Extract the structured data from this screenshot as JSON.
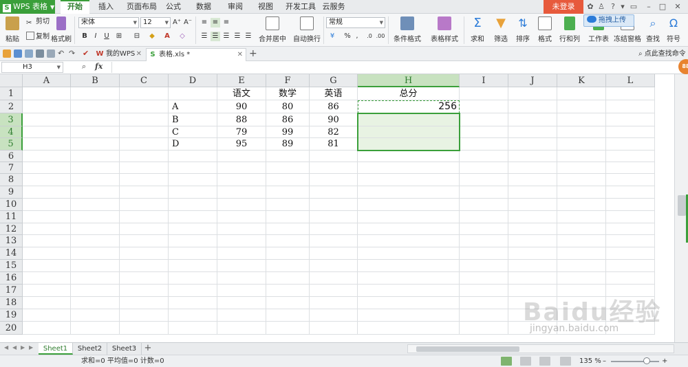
{
  "app": {
    "name": "WPS 表格",
    "menu_tabs": [
      "开始",
      "插入",
      "页面布局",
      "公式",
      "数据",
      "审阅",
      "视图",
      "开发工具",
      "云服务"
    ],
    "login_label": "未登录",
    "upload_tip": "拖拽上传"
  },
  "ribbon": {
    "paste": "粘贴",
    "cut": "剪切",
    "copy": "复制",
    "format_painter": "格式刷",
    "font_name": "宋体",
    "font_size": "12",
    "merge_center": "合并居中",
    "wrap_text": "自动换行",
    "number_format": "常规",
    "conditional_format": "条件格式",
    "table_style": "表格样式",
    "sum": "求和",
    "filter": "筛选",
    "sort": "排序",
    "format": "格式",
    "rows_cols": "行和列",
    "worksheet": "工作表",
    "freeze": "冻结窗格",
    "find": "查找",
    "symbol": "符号"
  },
  "doc_tabs": [
    {
      "label": "我的WPS"
    },
    {
      "label": "表格.xls *"
    }
  ],
  "command_search": "点此查找命令",
  "formula_bar": {
    "name_box": "H3",
    "fx": "fx",
    "formula": ""
  },
  "grid": {
    "columns": [
      "A",
      "B",
      "C",
      "D",
      "E",
      "F",
      "G",
      "H",
      "I",
      "J",
      "K",
      "L"
    ],
    "rows": [
      "1",
      "2",
      "3",
      "4",
      "5",
      "6",
      "7",
      "8",
      "9",
      "10",
      "11",
      "12",
      "13",
      "14",
      "15",
      "16",
      "17",
      "18",
      "19",
      "20"
    ],
    "headers": {
      "E": "语文",
      "F": "数学",
      "G": "英语",
      "H": "总分"
    },
    "data_rows": [
      {
        "name": "A",
        "chinese": "90",
        "math": "80",
        "english": "86",
        "total": "256"
      },
      {
        "name": "B",
        "chinese": "88",
        "math": "86",
        "english": "90",
        "total": ""
      },
      {
        "name": "C",
        "chinese": "79",
        "math": "99",
        "english": "82",
        "total": ""
      },
      {
        "name": "D",
        "chinese": "95",
        "math": "89",
        "english": "81",
        "total": ""
      }
    ]
  },
  "sheets": [
    "Sheet1",
    "Sheet2",
    "Sheet3"
  ],
  "status": {
    "summary": "求和=0  平均值=0  计数=0",
    "zoom": "135 %"
  },
  "watermark": {
    "logo": "Baidu经验",
    "url": "jingyan.baidu.com"
  },
  "colors": {
    "accent": "#3a9f3a",
    "login": "#e75a3c",
    "selection_fill": "#e8f3e3"
  }
}
